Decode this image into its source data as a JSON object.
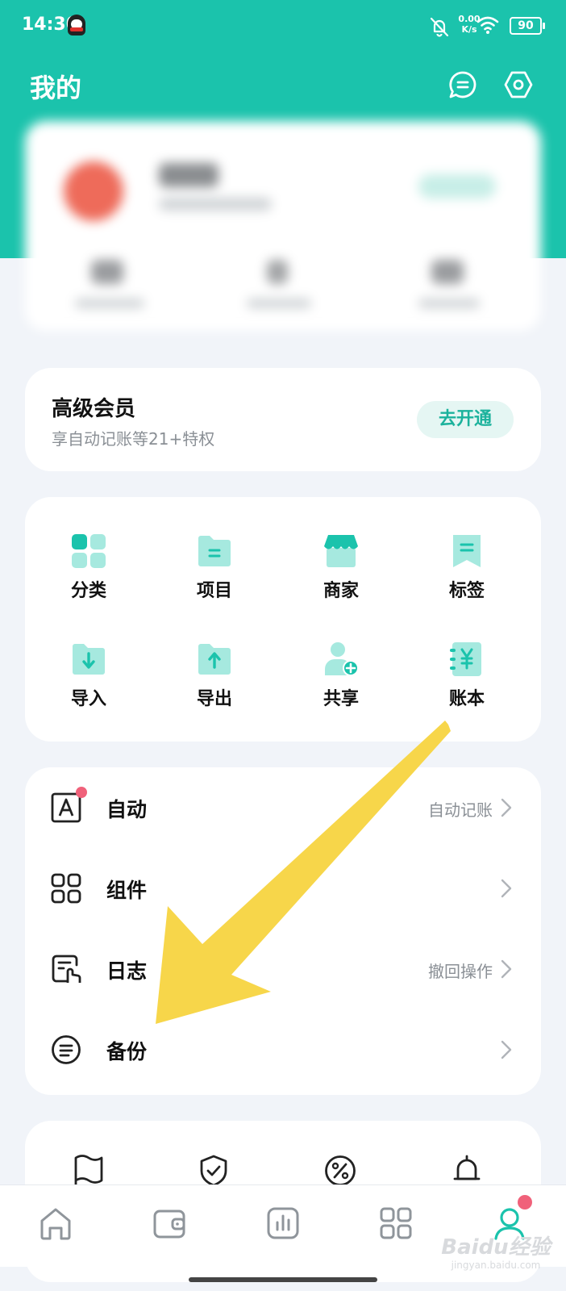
{
  "status_bar": {
    "time": "14:30",
    "net_speed_value": "0.00",
    "net_speed_unit": "K/s",
    "battery": "90"
  },
  "header": {
    "title": "我的"
  },
  "vip": {
    "title": "高级会员",
    "subtitle": "享自动记账等21+特权",
    "button": "去开通"
  },
  "grid": {
    "items": [
      {
        "label": "分类",
        "icon": "category-grid-icon"
      },
      {
        "label": "项目",
        "icon": "folder-project-icon"
      },
      {
        "label": "商家",
        "icon": "store-icon"
      },
      {
        "label": "标签",
        "icon": "bookmark-tag-icon"
      },
      {
        "label": "导入",
        "icon": "folder-import-icon"
      },
      {
        "label": "导出",
        "icon": "folder-export-icon"
      },
      {
        "label": "共享",
        "icon": "share-user-icon"
      },
      {
        "label": "账本",
        "icon": "ledger-yen-icon"
      }
    ]
  },
  "settings_list": {
    "items": [
      {
        "label": "自动",
        "value": "自动记账",
        "icon": "auto-a-icon"
      },
      {
        "label": "组件",
        "value": "",
        "icon": "widgets-icon"
      },
      {
        "label": "日志",
        "value": "撤回操作",
        "icon": "log-touch-icon"
      },
      {
        "label": "备份",
        "value": "",
        "icon": "backup-icon"
      }
    ]
  },
  "more_icons": [
    "flag-icon",
    "shield-check-icon",
    "percent-icon",
    "bell-icon"
  ],
  "tabbar": {
    "items": [
      {
        "icon": "home-icon",
        "active": false
      },
      {
        "icon": "wallet-icon",
        "active": false
      },
      {
        "icon": "stats-icon",
        "active": false
      },
      {
        "icon": "apps-icon",
        "active": false
      },
      {
        "icon": "profile-icon",
        "active": true
      }
    ]
  },
  "watermark": {
    "brand": "Baidu经验",
    "domain": "jingyan.baidu.com"
  },
  "colors": {
    "accent": "#1bc3ac",
    "accent_light": "#a6e9df",
    "notice_red": "#f0617a",
    "annotation_arrow": "#f7d64a"
  }
}
